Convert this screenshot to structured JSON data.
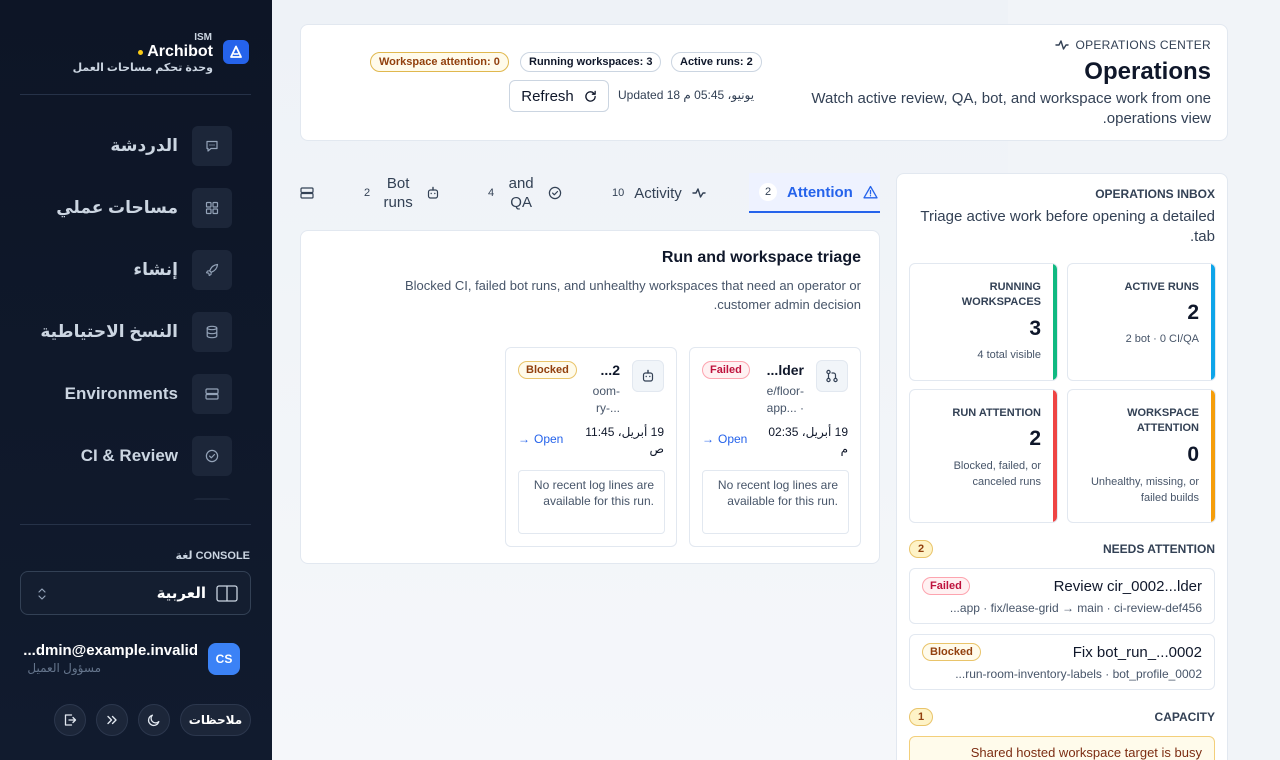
{
  "brand": {
    "tag": "ISM",
    "name": "Archibot",
    "tagline": "وحدة تحكم مساحات العمل"
  },
  "nav": {
    "items": [
      {
        "label": "الدردشة",
        "icon": "chat-icon"
      },
      {
        "label": "مساحات عملي",
        "icon": "grid-icon"
      },
      {
        "label": "إنشاء",
        "icon": "rocket-icon"
      },
      {
        "label": "النسخ الاحتياطية",
        "icon": "database-icon"
      },
      {
        "label": "Environments",
        "icon": "server-icon"
      },
      {
        "label": "CI & Review",
        "icon": "check-circle-icon"
      }
    ]
  },
  "console": {
    "label": "لغة CONSOLE",
    "language": "العربية"
  },
  "user": {
    "initials": "CS",
    "email": "dmin@example.invalid...",
    "role": "مسؤول العميل"
  },
  "footer": {
    "notes_label": "ملاحظات"
  },
  "header": {
    "eyebrow": "OPERATIONS CENTER",
    "title": "Operations",
    "description": "Watch active review, QA, bot, and workspace work from one operations view.",
    "pills": {
      "active_runs": "Active runs: 2",
      "running_workspaces": "Running workspaces: 3",
      "workspace_attention": "Workspace attention: 0"
    },
    "updated": "Updated 18 يونيو، 05:45 م",
    "refresh_label": "Refresh"
  },
  "inbox": {
    "eyebrow": "OPERATIONS INBOX",
    "description": "Triage active work before opening a detailed tab.",
    "metrics": {
      "active_runs": {
        "title": "ACTIVE RUNS",
        "value": "2",
        "sub": "2 bot · 0 CI/QA"
      },
      "running_workspaces": {
        "title": "RUNNING WORKSPACES",
        "value": "3",
        "sub": "4 total visible"
      },
      "workspace_attention": {
        "title": "WORKSPACE ATTENTION",
        "value": "0",
        "sub": "Unhealthy, missing, or failed builds"
      },
      "run_attention": {
        "title": "RUN ATTENTION",
        "value": "2",
        "sub": "Blocked, failed, or canceled runs"
      }
    },
    "needs_attention": {
      "title": "NEEDS ATTENTION",
      "count": "2",
      "items": [
        {
          "title": "Review cir_0002...lder",
          "status": "Failed",
          "meta": "app · fix/lease-grid → main · ci-review-def456..."
        },
        {
          "title": "Fix bot_run_...0002",
          "status": "Blocked",
          "meta": "run-room-inventory-labels · bot_profile_0002..."
        }
      ]
    },
    "capacity": {
      "title": "CAPACITY",
      "count": "1",
      "alert": "Shared hosted workspace target is busy"
    }
  },
  "tabs": [
    {
      "label": "Attention",
      "count": "2",
      "icon": "warning-icon"
    },
    {
      "label": "Activity",
      "count": "10",
      "icon": "pulse-icon"
    },
    {
      "label": "and QA",
      "count": "4",
      "icon": "check-circle-icon"
    },
    {
      "label": "Bot runs",
      "count": "2",
      "icon": "bot-icon"
    },
    {
      "label": "",
      "count": "",
      "icon": "server-icon"
    }
  ],
  "triage": {
    "title": "Run and workspace triage",
    "description": "Blocked CI, failed bot runs, and unhealthy workspaces that need an operator or customer admin decision.",
    "cards": [
      {
        "title": "lder...",
        "status": "Failed",
        "meta1": "e/floor-",
        "meta2": "app... ·",
        "date": "19 أبريل، 02:35 م",
        "open": "Open",
        "log": "No recent log lines are available for this run.",
        "icon": "git-pull-request-icon"
      },
      {
        "title": "2...",
        "status": "Blocked",
        "meta1": "oom-",
        "meta2": "ry-...",
        "date": "19 أبريل، 11:45 ص",
        "open": "Open",
        "log": "No recent log lines are available for this run.",
        "icon": "bot-icon"
      }
    ]
  },
  "colors": {
    "accent": "#2563eb",
    "metric_active_runs": "#0ea5e9",
    "metric_running_workspaces": "#10b981",
    "metric_workspace_attention": "#f59e0b",
    "metric_run_attention": "#ef4444"
  }
}
